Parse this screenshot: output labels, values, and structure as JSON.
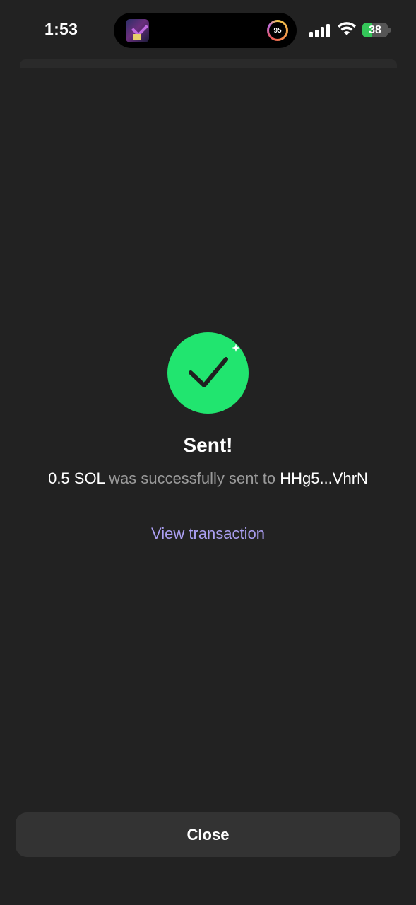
{
  "status_bar": {
    "time": "1:53",
    "activity_ring_value": "95",
    "battery_level": "38",
    "battery_fraction": 0.38,
    "signal_bars": 4,
    "icons": [
      "app-thumbnail-icon",
      "activity-ring-icon",
      "cellular-signal-icon",
      "wifi-icon",
      "battery-charging-icon"
    ]
  },
  "result": {
    "icon": "checkmark-icon",
    "title": "Sent!",
    "amount": "0.5 SOL",
    "message_middle": " was successfully sent to ",
    "recipient": "HHg5...VhrN",
    "view_link": "View transaction"
  },
  "footer": {
    "close_label": "Close"
  },
  "colors": {
    "background": "#222222",
    "success_green": "#21e56f",
    "link_purple": "#ab9ff2",
    "button_bg": "#333333",
    "muted_text": "#9a9a9a"
  }
}
